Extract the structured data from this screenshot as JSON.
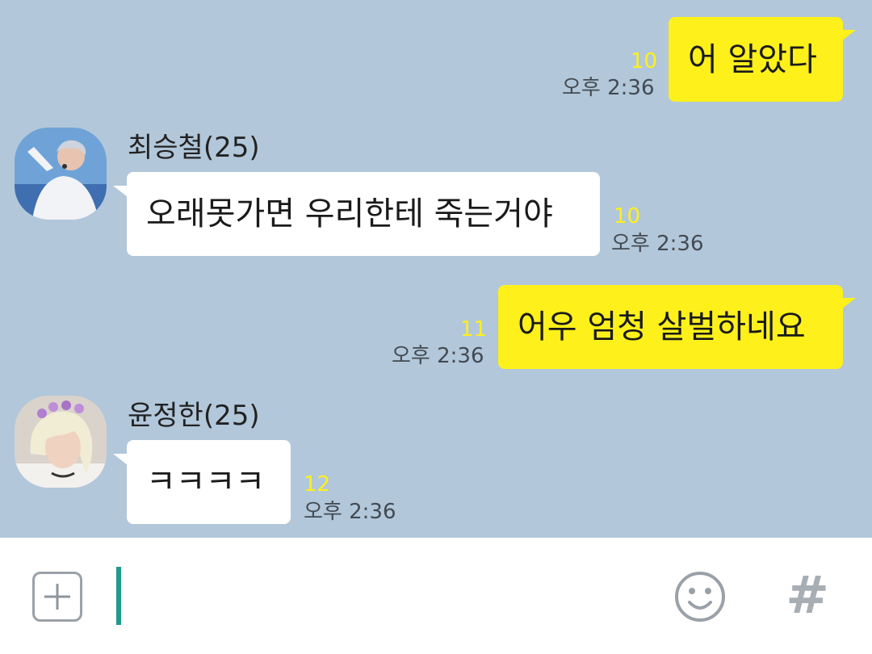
{
  "messages": [
    {
      "sender": "me",
      "text": "어 알았다",
      "unread": "10",
      "time": "오후 2:36"
    },
    {
      "sender": "최승철(25)",
      "text": "오래못가면 우리한테 죽는거야",
      "unread": "10",
      "time": "오후 2:36"
    },
    {
      "sender": "me",
      "text": "어우 엄청 살벌하네요",
      "unread": "11",
      "time": "오후 2:36"
    },
    {
      "sender": "윤정한(25)",
      "text": "ㅋㅋㅋㅋ",
      "unread": "12",
      "time": "오후 2:36"
    }
  ],
  "input_bar": {
    "plus_icon": "plus-icon",
    "emoji_icon": "smiley-icon",
    "hash_label": "#"
  },
  "colors": {
    "chat_background": "#b2c7da",
    "my_bubble": "#fef01b",
    "their_bubble": "#ffffff",
    "unread_count": "#fef01b",
    "cursor": "#1e9b8a"
  }
}
